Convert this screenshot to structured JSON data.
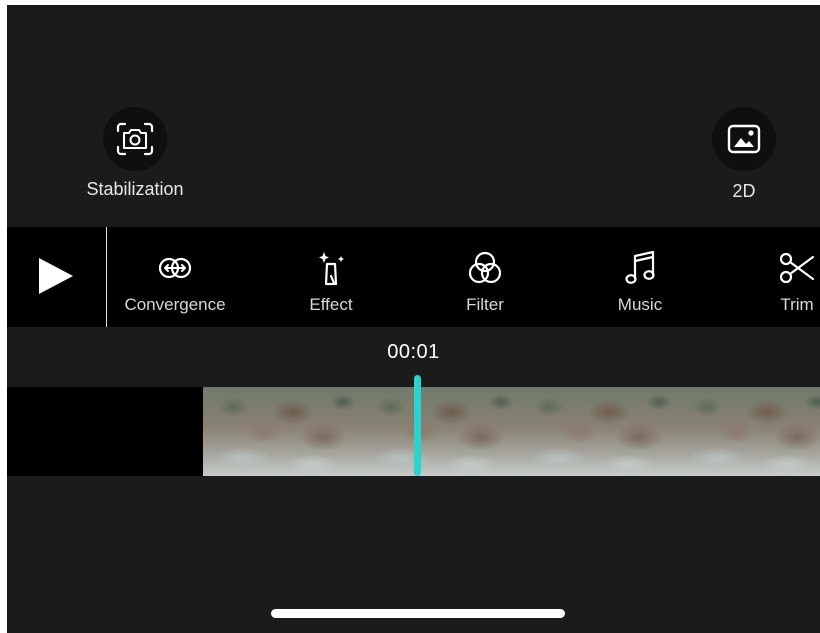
{
  "top": {
    "stabilization_label": "Stabilization",
    "mode_label": "2D"
  },
  "toolbar": {
    "tools": [
      {
        "label": "Convergence",
        "icon": "convergence-icon"
      },
      {
        "label": "Effect",
        "icon": "effect-icon"
      },
      {
        "label": "Filter",
        "icon": "filter-icon"
      },
      {
        "label": "Music",
        "icon": "music-icon"
      },
      {
        "label": "Trim",
        "icon": "scissors-icon"
      }
    ]
  },
  "timeline": {
    "current_time": "00:01",
    "playhead_color": "#2bd3cf"
  }
}
